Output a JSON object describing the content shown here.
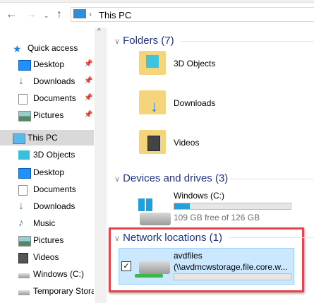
{
  "address": {
    "path": "This PC"
  },
  "sidebar": {
    "items": [
      {
        "label": "Quick access",
        "icon": "star-icon"
      },
      {
        "label": "Desktop",
        "icon": "desktop-icon",
        "pinned": true
      },
      {
        "label": "Downloads",
        "icon": "download-icon",
        "pinned": true
      },
      {
        "label": "Documents",
        "icon": "document-icon",
        "pinned": true
      },
      {
        "label": "Pictures",
        "icon": "pictures-icon",
        "pinned": true
      },
      {
        "label": "This PC",
        "icon": "computer-icon",
        "selected": true
      },
      {
        "label": "3D Objects",
        "icon": "cube-icon"
      },
      {
        "label": "Desktop",
        "icon": "desktop-icon"
      },
      {
        "label": "Documents",
        "icon": "document-icon"
      },
      {
        "label": "Downloads",
        "icon": "download-icon"
      },
      {
        "label": "Music",
        "icon": "music-icon"
      },
      {
        "label": "Pictures",
        "icon": "pictures-icon"
      },
      {
        "label": "Videos",
        "icon": "videos-icon"
      },
      {
        "label": "Windows (C:)",
        "icon": "drive-icon"
      },
      {
        "label": "Temporary Stora",
        "icon": "drive-icon"
      }
    ]
  },
  "main": {
    "folders_header": "Folders (7)",
    "folders": [
      "3D Objects",
      "Downloads",
      "Videos"
    ],
    "devices_header": "Devices and drives (3)",
    "drive": {
      "name": "Windows (C:)",
      "free_text": "109 GB free of 126 GB",
      "used_percent": 13.5
    },
    "network_header": "Network locations (1)",
    "network": {
      "name": "avdfiles",
      "path": "(\\\\avdmcwstorage.file.core.w...",
      "checked": true,
      "used_percent": 0
    }
  },
  "colors": {
    "accent": "#26a0da",
    "highlight": "#e8434a",
    "selection": "#cce8ff"
  }
}
